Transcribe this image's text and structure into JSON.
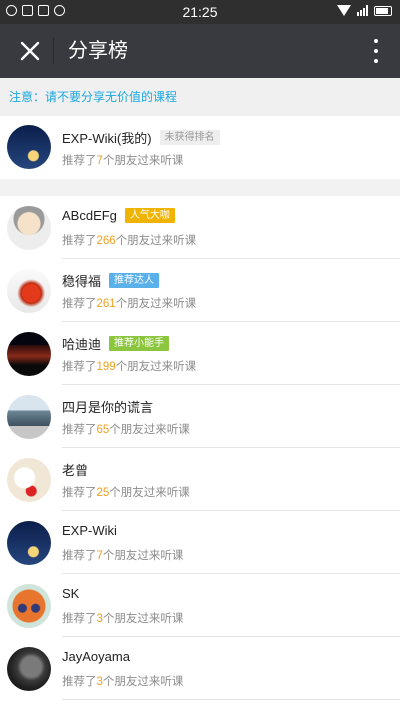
{
  "status_bar": {
    "time": "21:25"
  },
  "header": {
    "title": "分享榜"
  },
  "notice": "注意：请不要分享无价值的课程",
  "me": {
    "name": "EXP-Wiki(我的)",
    "badge": "未获得排名",
    "prefix": "推荐了",
    "count": "7",
    "suffix": "个朋友过来听课",
    "avatar": "night-house-avatar"
  },
  "colors": {
    "gold": "#f0b400",
    "blue": "#5ab0e8",
    "green": "#8cc63f",
    "accent": "#1aa8e0",
    "count": "#f0a020"
  },
  "rankings": [
    {
      "name": "ABcdEFg",
      "badge": "人气大咖",
      "badge_color": "#f0b400",
      "prefix": "推荐了",
      "count": "266",
      "suffix": "个朋友过来听课",
      "avatar": "cartoon-boy-avatar"
    },
    {
      "name": "稳得福",
      "badge": "推荐达人",
      "badge_color": "#5ab0e8",
      "prefix": "推荐了",
      "count": "261",
      "suffix": "个朋友过来听课",
      "avatar": "tulip-avatar"
    },
    {
      "name": "哈迪迪",
      "badge": "推荐小能手",
      "badge_color": "#8cc63f",
      "prefix": "推荐了",
      "count": "199",
      "suffix": "个朋友过来听课",
      "avatar": "dark-portrait-avatar"
    },
    {
      "name": "四月是你的谎言",
      "badge": "",
      "prefix": "推荐了",
      "count": "65",
      "suffix": "个朋友过来听课",
      "avatar": "anime-scene-avatar"
    },
    {
      "name": "老曾",
      "badge": "",
      "prefix": "推荐了",
      "count": "25",
      "suffix": "个朋友过来听课",
      "avatar": "cartoon-dog-avatar"
    },
    {
      "name": "EXP-Wiki",
      "badge": "",
      "prefix": "推荐了",
      "count": "7",
      "suffix": "个朋友过来听课",
      "avatar": "night-house-avatar"
    },
    {
      "name": "SK",
      "badge": "",
      "prefix": "推荐了",
      "count": "3",
      "suffix": "个朋友过来听课",
      "avatar": "fox-avatar"
    },
    {
      "name": "JayAoyama",
      "badge": "",
      "prefix": "推荐了",
      "count": "3",
      "suffix": "个朋友过来听课",
      "avatar": "grey-portrait-avatar"
    }
  ]
}
